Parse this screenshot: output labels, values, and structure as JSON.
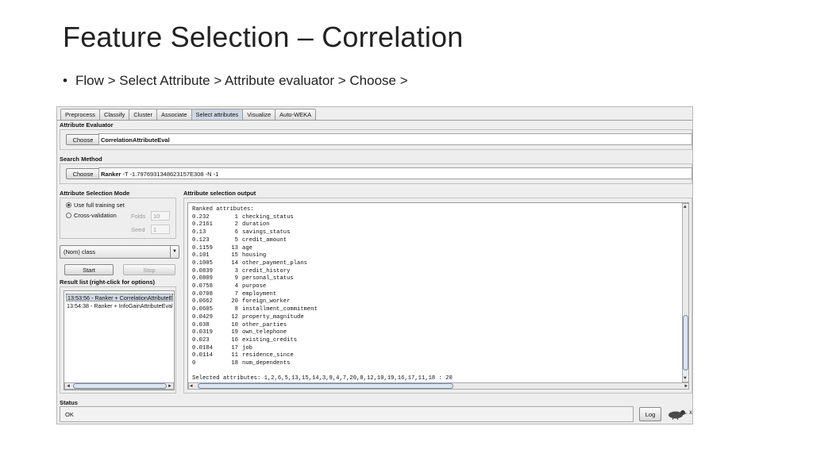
{
  "slide": {
    "title": "Feature Selection – Correlation",
    "bullet": "Flow > Select Attribute > Attribute evaluator > Choose >"
  },
  "weka": {
    "tabs": [
      "Preprocess",
      "Classify",
      "Cluster",
      "Associate",
      "Select attributes",
      "Visualize",
      "Auto-WEKA"
    ],
    "active_tab": "Select attributes",
    "evaluator": {
      "label": "Attribute Evaluator",
      "choose": "Choose",
      "value": "CorrelationAttributeEval"
    },
    "search": {
      "label": "Search Method",
      "choose": "Choose",
      "name": "Ranker",
      "args": " -T -1.7976931348623157E308 -N -1"
    },
    "mode": {
      "label": "Attribute Selection Mode",
      "full": "Use full training set",
      "cv": "Cross-validation",
      "folds_label": "Folds",
      "folds": "10",
      "seed_label": "Seed",
      "seed": "1"
    },
    "class_select": "(Nom) class",
    "start": "Start",
    "stop": "Stop",
    "results": {
      "label": "Result list (right-click for options)",
      "items": [
        "13:53:56 - Ranker + CorrelationAttributeE",
        "13:54:38 - Ranker + InfoGainAttributeEval"
      ]
    },
    "output": {
      "label": "Attribute selection output",
      "header": "Ranked attributes:",
      "rows": [
        {
          "score": "0.232",
          "idx": "1",
          "name": "checking_status"
        },
        {
          "score": "0.2161",
          "idx": "2",
          "name": "duration"
        },
        {
          "score": "0.13",
          "idx": "6",
          "name": "savings_status"
        },
        {
          "score": "0.123",
          "idx": "5",
          "name": "credit_amount"
        },
        {
          "score": "0.1159",
          "idx": "13",
          "name": "age"
        },
        {
          "score": "0.101",
          "idx": "15",
          "name": "housing"
        },
        {
          "score": "0.1005",
          "idx": "14",
          "name": "other_payment_plans"
        },
        {
          "score": "0.0839",
          "idx": "3",
          "name": "credit_history"
        },
        {
          "score": "0.0809",
          "idx": "9",
          "name": "personal_status"
        },
        {
          "score": "0.0758",
          "idx": "4",
          "name": "purpose"
        },
        {
          "score": "0.0708",
          "idx": "7",
          "name": "employment"
        },
        {
          "score": "0.0662",
          "idx": "20",
          "name": "foreign_worker"
        },
        {
          "score": "0.0605",
          "idx": "8",
          "name": "installment_commitment"
        },
        {
          "score": "0.0429",
          "idx": "12",
          "name": "property_magnitude"
        },
        {
          "score": "0.038",
          "idx": "10",
          "name": "other_parties"
        },
        {
          "score": "0.0319",
          "idx": "19",
          "name": "own_telephone"
        },
        {
          "score": "0.023",
          "idx": "16",
          "name": "existing_credits"
        },
        {
          "score": "0.0184",
          "idx": "17",
          "name": "job"
        },
        {
          "score": "0.0114",
          "idx": "11",
          "name": "residence_since"
        },
        {
          "score": "0",
          "idx": "18",
          "name": "num_dependents"
        }
      ],
      "selected": "Selected attributes: 1,2,6,5,13,15,14,3,9,4,7,20,8,12,10,19,16,17,11,18 : 20"
    },
    "status": {
      "label": "Status",
      "text": "OK",
      "log": "Log",
      "count": "x"
    }
  }
}
